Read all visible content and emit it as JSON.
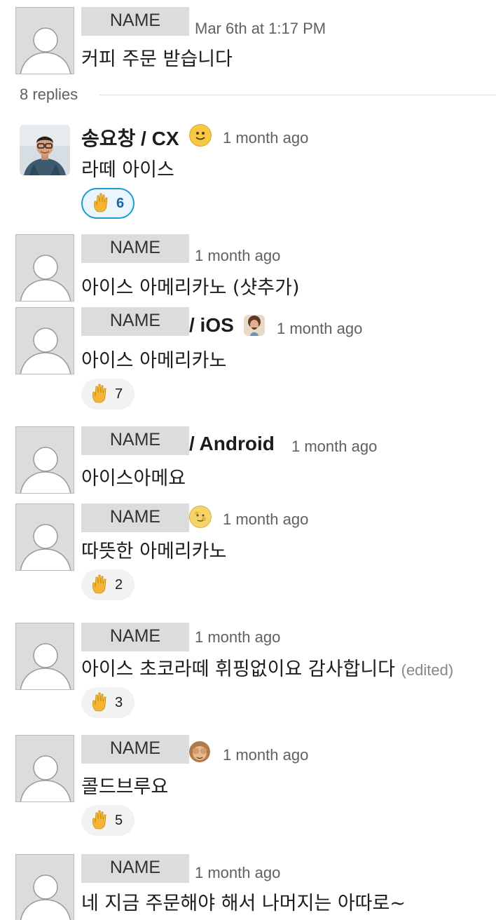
{
  "parent": {
    "name": "NAME",
    "timestamp": "Mar 6th at 1:17 PM",
    "text": "커피 주문 받습니다"
  },
  "thread": {
    "replies_label": "8 replies"
  },
  "messages": [
    {
      "name": "송요창 / CX",
      "status_emoji": "slightly-smiling-face",
      "timestamp": "1 month ago",
      "text": "라떼 아이스",
      "reaction": {
        "emoji": "raised-hand",
        "count": "6",
        "active": true
      }
    },
    {
      "name": "NAME",
      "timestamp": "1 month ago",
      "text": "아이스 아메리카노 (샷추가)"
    },
    {
      "name": "NAME",
      "name_suffix": "/ iOS",
      "status_emoji": "bob-ross",
      "timestamp": "1 month ago",
      "text": "아이스 아메리카노",
      "reaction": {
        "emoji": "raised-hand",
        "count": "7",
        "active": false
      }
    },
    {
      "name": "NAME",
      "name_suffix": "/ Android",
      "timestamp": "1 month ago",
      "text": "아이스아메요"
    },
    {
      "name": "NAME",
      "status_emoji": "full-moon-with-face",
      "timestamp": "1 month ago",
      "text": "따뜻한 아메리카노",
      "reaction": {
        "emoji": "raised-hand",
        "count": "2",
        "active": false
      }
    },
    {
      "name": "NAME",
      "timestamp": "1 month ago",
      "text": "아이스 초코라떼 휘핑없이요 감사합니다",
      "edited": "(edited)",
      "reaction": {
        "emoji": "raised-hand",
        "count": "3",
        "active": false
      }
    },
    {
      "name": "NAME",
      "status_emoji": "see-no-evil-monkey",
      "timestamp": "1 month ago",
      "text": "콜드브루요",
      "reaction": {
        "emoji": "raised-hand",
        "count": "5",
        "active": false
      }
    },
    {
      "name": "NAME",
      "timestamp": "1 month ago",
      "text": "네 지금 주문해야 해서 나머지는 아따로~"
    }
  ],
  "colors": {
    "active_reaction_border": "#1d9bd1",
    "active_reaction_bg": "#eaf5fd",
    "placeholder_gray": "#dcdcdc",
    "timestamp_gray": "#616061"
  }
}
